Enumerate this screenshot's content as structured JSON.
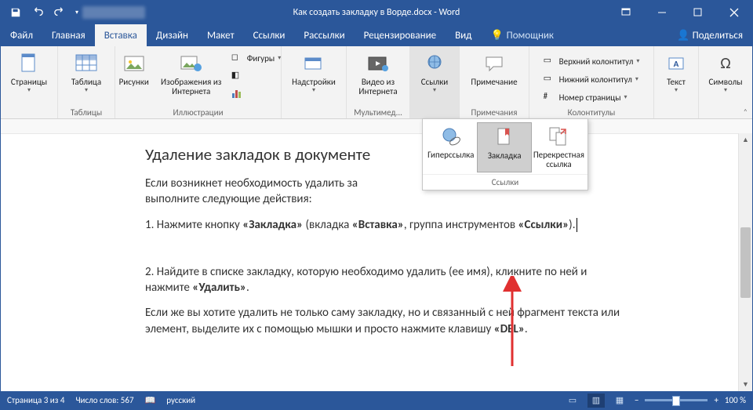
{
  "titlebar": {
    "title": "Как создать закладку в Ворде.docx - Word"
  },
  "tabs": [
    "Файл",
    "Главная",
    "Вставка",
    "Дизайн",
    "Макет",
    "Ссылки",
    "Рассылки",
    "Рецензирование",
    "Вид"
  ],
  "active_tab_index": 2,
  "helper": "Помощник",
  "share": "Поделиться",
  "ribbon": {
    "pages": {
      "btn": "Страницы",
      "group": ""
    },
    "tables": {
      "btn": "Таблица",
      "group": "Таблицы"
    },
    "illus": {
      "btns": [
        "Рисунки",
        "Изображения из Интернета"
      ],
      "shapes": "Фигуры",
      "group": "Иллюстрации"
    },
    "addins": {
      "btn": "Надстройки",
      "group": ""
    },
    "media": {
      "btn": "Видео из Интернета",
      "group": "Мультимед..."
    },
    "links": {
      "btn": "Ссылки",
      "group": ""
    },
    "comments": {
      "btn": "Примечание",
      "group": "Примечания"
    },
    "headerfooter": {
      "items": [
        "Верхний колонтитул",
        "Нижний колонтитул",
        "Номер страницы"
      ],
      "group": "Колонтитулы"
    },
    "text": {
      "btn": "Текст",
      "group": ""
    },
    "symbols": {
      "btn": "Символы",
      "group": ""
    }
  },
  "dropdown": {
    "items": [
      "Гиперссылка",
      "Закладка",
      "Перекрестная ссылка"
    ],
    "selected_index": 1,
    "footer": "Ссылки"
  },
  "document": {
    "heading": "Удаление закладок в документе",
    "p1a": "Если возникнет необходимость удалить за",
    "p1b": "выполните следующие действия:",
    "p2_pre": "1. Нажмите кнопку ",
    "p2_b1": "«Закладка»",
    "p2_mid": " (вкладка ",
    "p2_b2": "«Вставка»",
    "p2_mid2": ", группа инструментов ",
    "p2_b3": "«Ссылки»",
    "p2_end": ").",
    "p3_pre": "2. Найдите в списке закладку, которую необходимо удалить (ее имя), кликните по ней и нажмите ",
    "p3_b": "«Удалить»",
    "p3_end": ".",
    "p4_pre": "Если же вы хотите удалить не только саму закладку, но и связанный с ней фрагмент текста или элемент, выделите их с помощью мышки и просто нажмите клавишу ",
    "p4_b": "«DEL»",
    "p4_end": "."
  },
  "status": {
    "page": "Страница 3 из 4",
    "words": "Число слов: 567",
    "lang": "русский",
    "zoom": "100 %"
  }
}
